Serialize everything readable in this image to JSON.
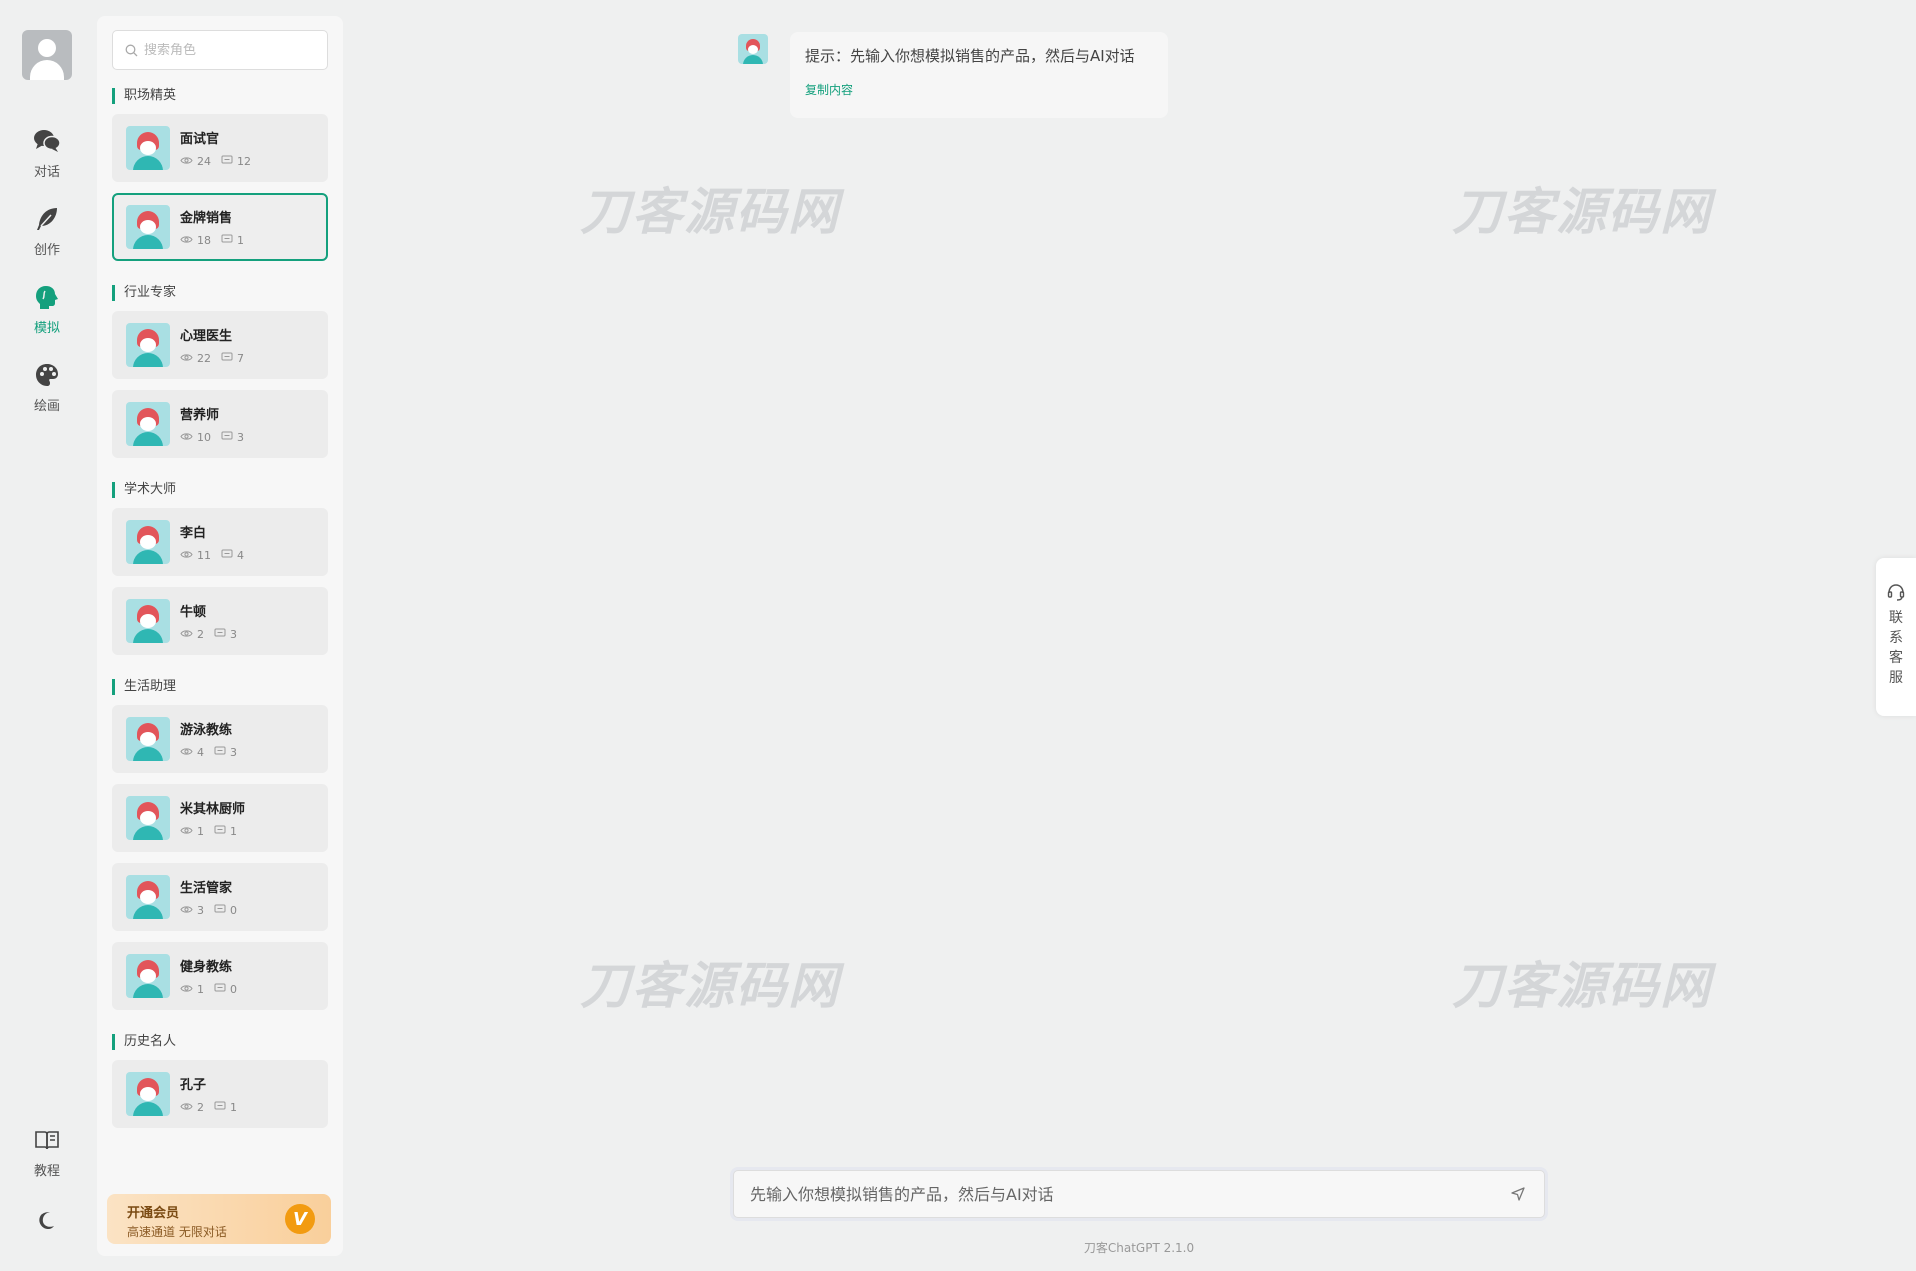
{
  "rail": {
    "items": [
      {
        "label": "对话",
        "icon": "chat-icon"
      },
      {
        "label": "创作",
        "icon": "feather-icon"
      },
      {
        "label": "模拟",
        "icon": "head-icon"
      },
      {
        "label": "绘画",
        "icon": "palette-icon"
      }
    ],
    "active": "模拟",
    "tutorial_label": "教程",
    "theme_icon": "moon-icon"
  },
  "search": {
    "placeholder": "搜索角色"
  },
  "sections": [
    {
      "title": "职场精英",
      "roles": [
        {
          "name": "面试官",
          "views": "24",
          "chats": "12"
        },
        {
          "name": "金牌销售",
          "views": "18",
          "chats": "1"
        }
      ]
    },
    {
      "title": "行业专家",
      "roles": [
        {
          "name": "心理医生",
          "views": "22",
          "chats": "7"
        },
        {
          "name": "营养师",
          "views": "10",
          "chats": "3"
        }
      ]
    },
    {
      "title": "学术大师",
      "roles": [
        {
          "name": "李白",
          "views": "11",
          "chats": "4"
        },
        {
          "name": "牛顿",
          "views": "2",
          "chats": "3"
        }
      ]
    },
    {
      "title": "生活助理",
      "roles": [
        {
          "name": "游泳教练",
          "views": "4",
          "chats": "3"
        },
        {
          "name": "米其林厨师",
          "views": "1",
          "chats": "1"
        },
        {
          "name": "生活管家",
          "views": "3",
          "chats": "0"
        },
        {
          "name": "健身教练",
          "views": "1",
          "chats": "0"
        }
      ]
    },
    {
      "title": "历史名人",
      "roles": [
        {
          "name": "孔子",
          "views": "2",
          "chats": "1"
        }
      ]
    }
  ],
  "vip": {
    "title": "开通会员",
    "subtitle": "高速通道 无限对话",
    "badge": "V"
  },
  "chat": {
    "message": "提示：先输入你想模拟销售的产品，然后与AI对话",
    "copy_label": "复制内容"
  },
  "watermark": "刀客源码网",
  "composer": {
    "placeholder": "先输入你想模拟销售的产品，然后与AI对话"
  },
  "version": "刀客ChatGPT 2.1.0",
  "support": {
    "label": "联系客服"
  },
  "colors": {
    "accent": "#14a07d",
    "vip_badge": "#f29b11"
  }
}
